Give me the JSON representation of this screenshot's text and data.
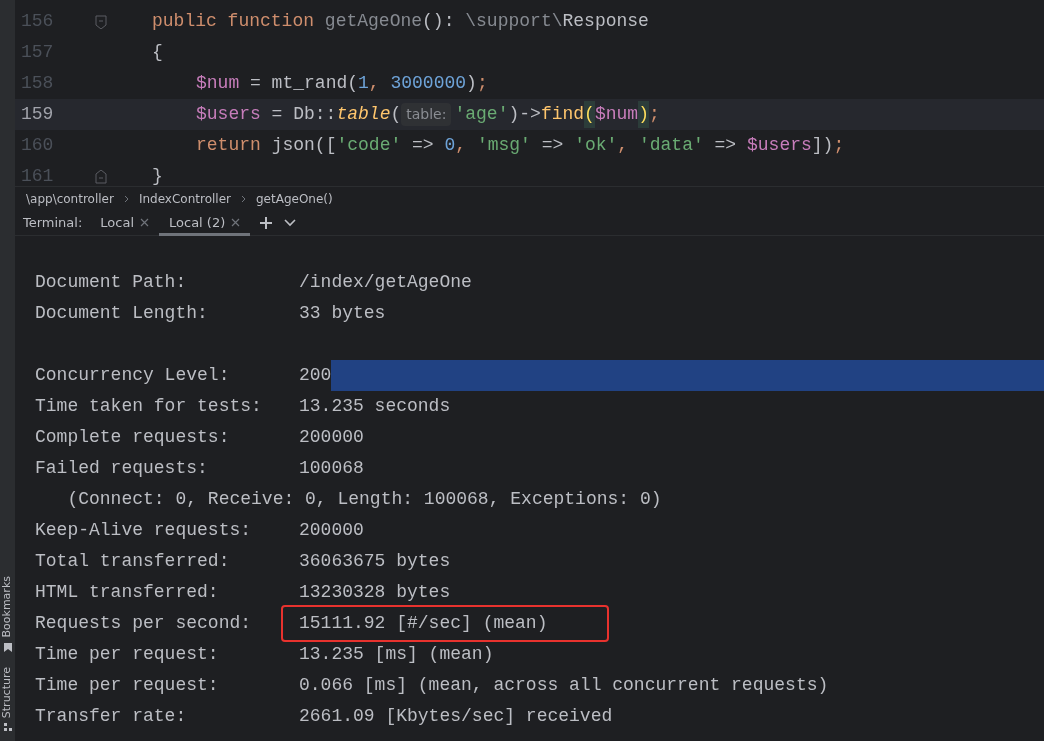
{
  "sidebar": {
    "items": [
      {
        "label": "Bookmarks"
      },
      {
        "label": "Structure"
      }
    ]
  },
  "editor": {
    "lines": [
      {
        "number": "156",
        "current": false,
        "kind": "signature",
        "tokens": [
          {
            "kind": "keyword",
            "text": "public function "
          },
          {
            "kind": "unused",
            "text": "getAgeOne"
          },
          {
            "kind": "plain",
            "text": "(): "
          },
          {
            "kind": "unused",
            "text": "\\support\\"
          },
          {
            "kind": "plain",
            "text": "Response"
          }
        ]
      },
      {
        "number": "157",
        "current": false,
        "kind": "brace",
        "tokens": [
          {
            "kind": "plain",
            "text": "{"
          }
        ]
      },
      {
        "number": "158",
        "current": false,
        "kind": "statement",
        "tokens": [
          {
            "kind": "var",
            "text": "$num"
          },
          {
            "kind": "plain",
            "text": " = mt_rand("
          },
          {
            "kind": "number",
            "text": "1"
          },
          {
            "kind": "keyword",
            "text": ", "
          },
          {
            "kind": "number",
            "text": "3000000"
          },
          {
            "kind": "plain",
            "text": ")"
          },
          {
            "kind": "keyword",
            "text": ";"
          }
        ]
      },
      {
        "number": "159",
        "current": true,
        "kind": "statement",
        "tokens": [
          {
            "kind": "var",
            "text": "$users"
          },
          {
            "kind": "plain",
            "text": " = Db::"
          },
          {
            "kind": "static",
            "text": "table"
          },
          {
            "kind": "plain",
            "text": "("
          },
          {
            "kind": "hint",
            "text": "table:"
          },
          {
            "kind": "string",
            "text": "'age'"
          },
          {
            "kind": "plain",
            "text": ")->"
          },
          {
            "kind": "method",
            "text": "find"
          },
          {
            "kind": "paren-match",
            "text": "("
          },
          {
            "kind": "var",
            "text": "$num"
          },
          {
            "kind": "paren-match",
            "text": ")"
          },
          {
            "kind": "keyword",
            "text": ";"
          }
        ]
      },
      {
        "number": "160",
        "current": false,
        "kind": "statement",
        "tokens": [
          {
            "kind": "keyword",
            "text": "return "
          },
          {
            "kind": "plain",
            "text": "json(["
          },
          {
            "kind": "string",
            "text": "'code'"
          },
          {
            "kind": "plain",
            "text": " => "
          },
          {
            "kind": "number",
            "text": "0"
          },
          {
            "kind": "keyword",
            "text": ", "
          },
          {
            "kind": "string",
            "text": "'msg'"
          },
          {
            "kind": "plain",
            "text": " => "
          },
          {
            "kind": "string",
            "text": "'ok'"
          },
          {
            "kind": "keyword",
            "text": ", "
          },
          {
            "kind": "string",
            "text": "'data'"
          },
          {
            "kind": "plain",
            "text": " => "
          },
          {
            "kind": "var",
            "text": "$users"
          },
          {
            "kind": "plain",
            "text": "])"
          },
          {
            "kind": "keyword",
            "text": ";"
          }
        ]
      },
      {
        "number": "161",
        "current": false,
        "kind": "closing",
        "tokens": [
          {
            "kind": "plain",
            "text": "}"
          }
        ]
      }
    ]
  },
  "breadcrumbs": [
    "\\app\\controller",
    "IndexController",
    "getAgeOne()"
  ],
  "terminal": {
    "label": "Terminal:",
    "tabs": [
      {
        "label": "Local",
        "selected": false
      },
      {
        "label": "Local (2)",
        "selected": true
      }
    ],
    "lines": [
      {
        "kind": "blank"
      },
      {
        "kind": "field",
        "label": "Document Path:",
        "value": "/index/getAgeOne"
      },
      {
        "kind": "field",
        "label": "Document Length:",
        "value": "33 bytes"
      },
      {
        "kind": "blank"
      },
      {
        "kind": "field",
        "label": "Concurrency Level:",
        "value": "200",
        "selection": true
      },
      {
        "kind": "field",
        "label": "Time taken for tests:",
        "value": "13.235 seconds"
      },
      {
        "kind": "field",
        "label": "Complete requests:",
        "value": "200000"
      },
      {
        "kind": "field",
        "label": "Failed requests:",
        "value": "100068"
      },
      {
        "kind": "detail",
        "text": "   (Connect: 0, Receive: 0, Length: 100068, Exceptions: 0)"
      },
      {
        "kind": "field",
        "label": "Keep-Alive requests:",
        "value": "200000"
      },
      {
        "kind": "field",
        "label": "Total transferred:",
        "value": "36063675 bytes"
      },
      {
        "kind": "field",
        "label": "HTML transferred:",
        "value": "13230328 bytes"
      },
      {
        "kind": "field",
        "label": "Requests per second:",
        "value": "15111.92 [#/sec] (mean)",
        "highlighted": true
      },
      {
        "kind": "field",
        "label": "Time per request:",
        "value": "13.235 [ms] (mean)"
      },
      {
        "kind": "field",
        "label": "Time per request:",
        "value": "0.066 [ms] (mean, across all concurrent requests)"
      },
      {
        "kind": "field",
        "label": "Transfer rate:",
        "value": "2661.09 [Kbytes/sec] received"
      }
    ]
  }
}
